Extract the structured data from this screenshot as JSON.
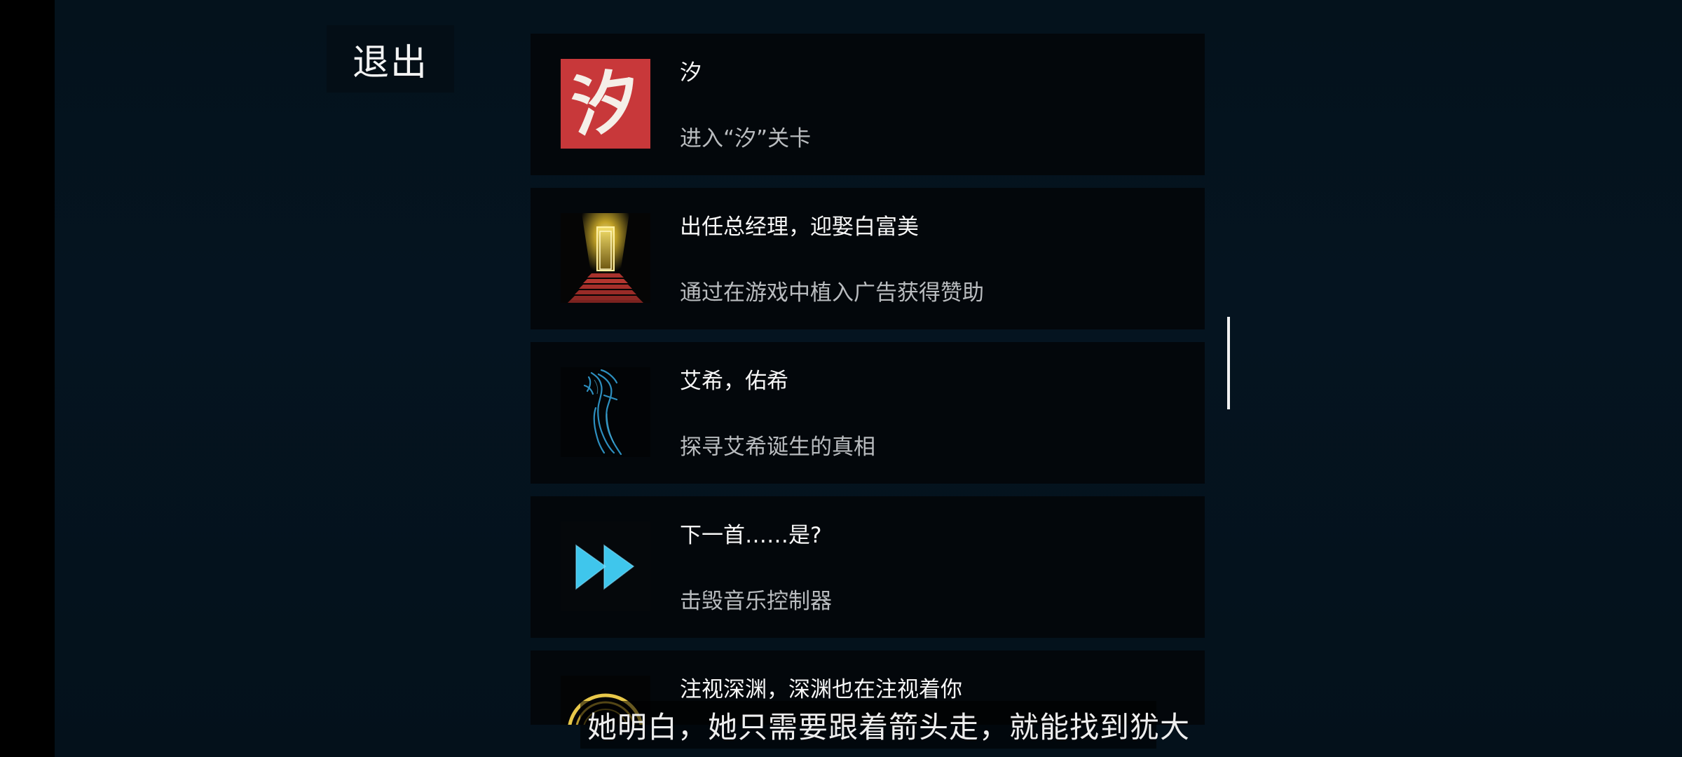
{
  "exit_label": "退出",
  "achievements": [
    {
      "title": "汐",
      "description": "进入“汐”关卡",
      "icon": "xi-character-icon",
      "icon_glyph": "汐"
    },
    {
      "title": "出任总经理，迎娶白富美",
      "description": "通过在游戏中植入广告获得赞助",
      "icon": "golden-door-stairs-icon"
    },
    {
      "title": "艾希，佑希",
      "description": "探寻艾希诞生的真相",
      "icon": "scythe-icon"
    },
    {
      "title": "下一首……是?",
      "description": "击毁音乐控制器",
      "icon": "fast-forward-icon"
    },
    {
      "title": "注视深渊，深渊也在注视着你",
      "description": "",
      "icon": "golden-ring-icon"
    }
  ],
  "subtitle": "她明白，她只需要跟着箭头走，就能找到犹大",
  "colors": {
    "background": "#04121c",
    "card": "#03070b",
    "xi_icon_red": "#c8383a",
    "accent_cyan": "#3fc6ec",
    "gold": "#e8c84a"
  }
}
